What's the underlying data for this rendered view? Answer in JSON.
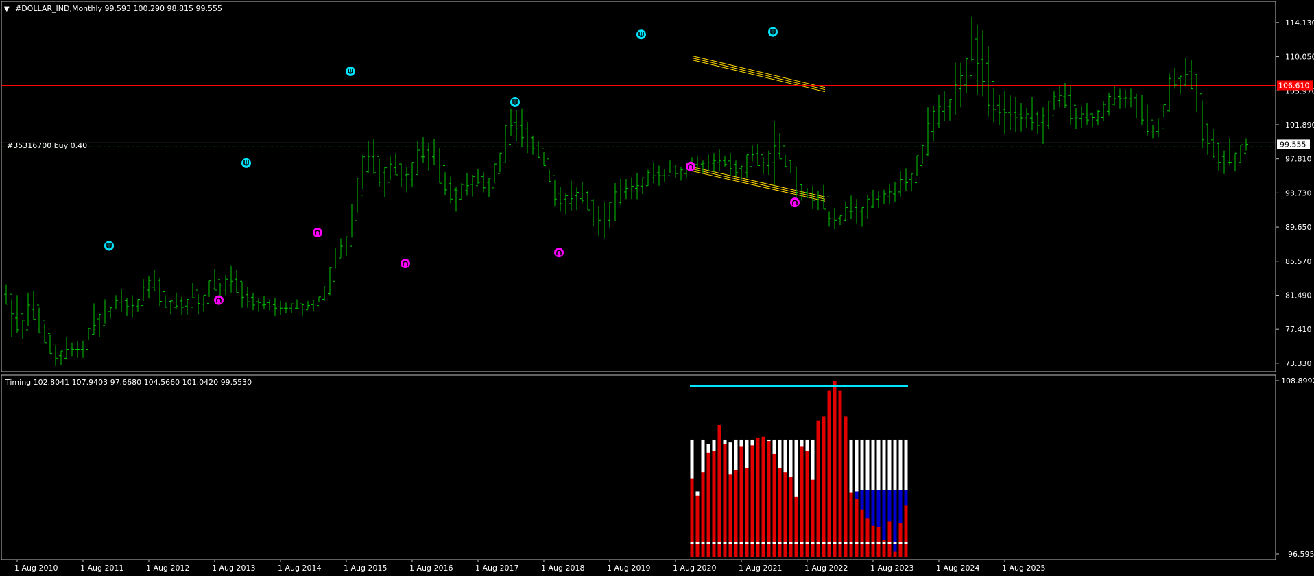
{
  "colors": {
    "background": "#000000",
    "frame": "#c0c0c0",
    "bar": "#00c800",
    "up_arrow": "#00e5ff",
    "down_arrow": "#ff00ff",
    "resistance": "#ff0000",
    "order": "#00c800",
    "channel": "#ffd700",
    "hist_red": "#e00000",
    "hist_white": "#ffffff",
    "hist_blue": "#0000cc",
    "hist_line": "#00e5ff"
  },
  "main": {
    "title_arrow": "▼",
    "header": "#DOLLAR_IND,Monthly  99.593 100.290 98.815 99.555",
    "order_label": "#35316700 buy 0.40",
    "price_tag": "99.555",
    "resistance_tag": "106.610",
    "price_ticks": [
      "114.130",
      "110.050",
      "105.970",
      "101.890",
      "97.810",
      "93.730",
      "89.650",
      "85.570",
      "81.490",
      "77.410",
      "73.330"
    ],
    "ylim": [
      72.5,
      116.5
    ]
  },
  "date_ticks": [
    "1 Aug 2010",
    "1 Aug 2011",
    "1 Aug 2012",
    "1 Aug 2013",
    "1 Aug 2014",
    "1 Aug 2015",
    "1 Aug 2016",
    "1 Aug 2017",
    "1 Aug 2018",
    "1 Aug 2019",
    "1 Aug 2020",
    "1 Aug 2021",
    "1 Aug 2022",
    "1 Aug 2023",
    "1 Aug 2024",
    "1 Aug 2025"
  ],
  "sub": {
    "header": "Timing 102.8041 107.9403 97.6680 104.5660 101.0420 99.5530",
    "top_tick": "108.8992",
    "bottom_tick": "96.5957"
  },
  "chart_data": [
    {
      "type": "ohlc",
      "title": "#DOLLAR_IND,Monthly",
      "x_start": "2010-06",
      "x_step": "1 month",
      "points": [
        [
          82.8,
          80.4
        ],
        [
          81.0,
          76.5
        ],
        [
          81.5,
          77.0
        ],
        [
          78.5,
          76.2
        ],
        [
          81.8,
          77.8
        ],
        [
          82.0,
          78.6
        ],
        [
          80.0,
          77.0
        ],
        [
          78.0,
          75.8
        ],
        [
          76.8,
          74.5
        ],
        [
          75.5,
          73.0
        ],
        [
          74.8,
          73.1
        ],
        [
          76.5,
          73.8
        ],
        [
          75.8,
          74.2
        ],
        [
          76.0,
          74.0
        ],
        [
          76.0,
          74.0
        ],
        [
          77.5,
          76.1
        ],
        [
          80.5,
          76.8
        ],
        [
          79.2,
          76.5
        ],
        [
          81.0,
          78.1
        ],
        [
          80.0,
          78.7
        ],
        [
          81.5,
          79.8
        ],
        [
          82.2,
          79.5
        ],
        [
          81.2,
          79.0
        ],
        [
          81.5,
          78.8
        ],
        [
          81.0,
          79.5
        ],
        [
          83.4,
          80.8
        ],
        [
          83.8,
          81.1
        ],
        [
          84.5,
          82.0
        ],
        [
          83.6,
          80.2
        ],
        [
          81.5,
          80.0
        ],
        [
          80.9,
          79.2
        ],
        [
          81.8,
          79.8
        ],
        [
          81.3,
          79.1
        ],
        [
          81.0,
          79.1
        ],
        [
          83.0,
          81.2
        ],
        [
          81.6,
          79.2
        ],
        [
          81.5,
          79.5
        ],
        [
          83.2,
          81.3
        ],
        [
          84.6,
          82.1
        ],
        [
          83.0,
          81.0
        ],
        [
          83.9,
          81.5
        ],
        [
          85.0,
          81.8
        ],
        [
          84.5,
          81.8
        ],
        [
          83.1,
          80.0
        ],
        [
          82.5,
          80.0
        ],
        [
          81.7,
          79.7
        ],
        [
          81.1,
          79.5
        ],
        [
          81.4,
          79.8
        ],
        [
          81.0,
          79.7
        ],
        [
          81.2,
          79.0
        ],
        [
          80.8,
          79.1
        ],
        [
          80.6,
          79.3
        ],
        [
          80.5,
          79.4
        ],
        [
          81.0,
          79.9
        ],
        [
          80.5,
          79.0
        ],
        [
          80.8,
          79.9
        ],
        [
          80.9,
          79.6
        ],
        [
          81.3,
          80.7
        ],
        [
          82.5,
          80.8
        ],
        [
          84.8,
          81.5
        ],
        [
          87.2,
          84.7
        ],
        [
          88.3,
          86.0
        ],
        [
          88.5,
          86.2
        ],
        [
          92.4,
          88.4
        ],
        [
          95.5,
          91.4
        ],
        [
          98.3,
          94.2
        ],
        [
          100.0,
          96.1
        ],
        [
          100.2,
          96.0
        ],
        [
          97.8,
          94.5
        ],
        [
          96.8,
          93.2
        ],
        [
          98.2,
          95.3
        ],
        [
          98.5,
          95.9
        ],
        [
          97.3,
          94.5
        ],
        [
          96.8,
          93.8
        ],
        [
          97.4,
          94.5
        ],
        [
          100.0,
          96.1
        ],
        [
          100.4,
          97.3
        ],
        [
          99.7,
          96.4
        ],
        [
          100.2,
          97.1
        ],
        [
          99.1,
          94.9
        ],
        [
          96.2,
          93.5
        ],
        [
          95.7,
          92.5
        ],
        [
          94.5,
          91.5
        ],
        [
          94.9,
          93.1
        ],
        [
          96.1,
          93.4
        ],
        [
          95.9,
          93.3
        ],
        [
          96.6,
          94.8
        ],
        [
          96.2,
          93.8
        ],
        [
          95.5,
          93.2
        ],
        [
          97.2,
          94.9
        ],
        [
          98.5,
          96.2
        ],
        [
          101.8,
          97.3
        ],
        [
          103.8,
          100.5
        ],
        [
          103.6,
          100.0
        ],
        [
          103.8,
          99.2
        ],
        [
          102.2,
          98.5
        ],
        [
          100.6,
          98.3
        ],
        [
          100.0,
          98.0
        ],
        [
          98.6,
          97.0
        ],
        [
          96.5,
          95.1
        ],
        [
          95.3,
          92.1
        ],
        [
          94.5,
          91.5
        ],
        [
          93.7,
          91.2
        ],
        [
          95.2,
          91.6
        ],
        [
          94.4,
          91.7
        ],
        [
          95.1,
          92.5
        ],
        [
          94.0,
          91.7
        ],
        [
          93.0,
          89.7
        ],
        [
          92.1,
          88.6
        ],
        [
          92.6,
          88.3
        ],
        [
          92.6,
          89.6
        ],
        [
          94.9,
          90.3
        ],
        [
          95.4,
          92.3
        ],
        [
          95.4,
          93.0
        ],
        [
          95.6,
          93.0
        ],
        [
          96.1,
          93.0
        ],
        [
          95.6,
          93.6
        ],
        [
          96.5,
          94.6
        ],
        [
          97.4,
          94.9
        ],
        [
          97.0,
          94.6
        ],
        [
          96.6,
          95.0
        ],
        [
          97.6,
          96.1
        ],
        [
          97.1,
          95.6
        ],
        [
          96.9,
          95.2
        ],
        [
          97.4,
          95.6
        ],
        [
          98.0,
          96.3
        ],
        [
          98.1,
          96.3
        ],
        [
          97.6,
          96.1
        ],
        [
          98.3,
          96.3
        ],
        [
          98.5,
          96.2
        ],
        [
          98.9,
          96.3
        ],
        [
          98.2,
          96.9
        ],
        [
          98.5,
          95.8
        ],
        [
          97.6,
          95.7
        ],
        [
          97.0,
          95.3
        ],
        [
          98.3,
          95.5
        ],
        [
          99.4,
          97.5
        ],
        [
          99.6,
          97.0
        ],
        [
          98.0,
          96.0
        ],
        [
          98.8,
          95.9
        ],
        [
          102.3,
          94.6
        ],
        [
          100.9,
          97.8
        ],
        [
          98.3,
          96.9
        ],
        [
          97.6,
          96.1
        ],
        [
          96.9,
          92.5
        ],
        [
          94.8,
          92.8
        ],
        [
          94.3,
          93.1
        ],
        [
          94.6,
          91.8
        ],
        [
          94.0,
          91.7
        ],
        [
          94.7,
          91.8
        ],
        [
          91.5,
          89.7
        ],
        [
          91.9,
          89.4
        ],
        [
          91.0,
          89.9
        ],
        [
          92.7,
          90.4
        ],
        [
          93.4,
          90.6
        ],
        [
          93.0,
          90.1
        ],
        [
          92.0,
          89.7
        ],
        [
          93.5,
          90.6
        ],
        [
          94.1,
          91.9
        ],
        [
          93.9,
          91.9
        ],
        [
          94.1,
          92.4
        ],
        [
          94.8,
          92.4
        ],
        [
          95.0,
          92.7
        ],
        [
          96.3,
          93.3
        ],
        [
          96.7,
          94.0
        ],
        [
          96.0,
          93.9
        ],
        [
          98.2,
          95.8
        ],
        [
          99.4,
          97.2
        ],
        [
          104.0,
          98.2
        ],
        [
          104.1,
          100.0
        ],
        [
          105.5,
          101.5
        ],
        [
          105.9,
          102.3
        ],
        [
          104.9,
          102.4
        ],
        [
          109.3,
          103.1
        ],
        [
          109.3,
          104.0
        ],
        [
          109.8,
          105.7
        ],
        [
          114.8,
          109.5
        ],
        [
          113.9,
          105.5
        ],
        [
          113.2,
          105.3
        ],
        [
          111.3,
          102.9
        ],
        [
          106.3,
          102.2
        ],
        [
          105.5,
          101.9
        ],
        [
          105.9,
          100.8
        ],
        [
          105.4,
          101.3
        ],
        [
          105.2,
          101.0
        ],
        [
          104.5,
          101.1
        ],
        [
          103.9,
          101.5
        ],
        [
          105.2,
          101.2
        ],
        [
          103.5,
          100.8
        ],
        [
          104.0,
          99.6
        ],
        [
          104.7,
          101.4
        ],
        [
          105.9,
          103.7
        ],
        [
          106.5,
          104.0
        ],
        [
          106.9,
          103.9
        ],
        [
          106.6,
          101.9
        ],
        [
          103.9,
          101.4
        ],
        [
          104.1,
          101.5
        ],
        [
          104.5,
          101.9
        ],
        [
          103.3,
          101.6
        ],
        [
          103.7,
          101.8
        ],
        [
          104.7,
          102.3
        ],
        [
          105.7,
          103.0
        ],
        [
          106.5,
          104.1
        ],
        [
          106.2,
          103.8
        ],
        [
          106.1,
          103.9
        ],
        [
          106.2,
          104.0
        ],
        [
          105.6,
          102.7
        ],
        [
          105.5,
          101.8
        ],
        [
          104.3,
          100.6
        ],
        [
          101.9,
          100.3
        ],
        [
          102.6,
          100.4
        ],
        [
          104.3,
          102.8
        ],
        [
          108.0,
          103.4
        ],
        [
          108.7,
          106.2
        ],
        [
          107.7,
          105.6
        ],
        [
          109.9,
          106.7
        ],
        [
          109.6,
          106.2
        ],
        [
          107.8,
          103.4
        ],
        [
          104.8,
          99.1
        ],
        [
          101.9,
          98.3
        ],
        [
          101.4,
          97.9
        ],
        [
          99.8,
          96.4
        ],
        [
          98.8,
          96.0
        ],
        [
          100.3,
          97.0
        ],
        [
          98.5,
          96.3
        ],
        [
          99.5,
          97.5
        ],
        [
          100.3,
          98.8
        ]
      ]
    },
    {
      "type": "bar",
      "title": "Timing",
      "ylim": [
        96.5957,
        108.8992
      ],
      "level_line": 108.5,
      "series": [
        {
          "values": [
            104.8,
            101.2,
            104.8,
            104.5,
            104.8,
            104.8,
            104.8,
            104.6,
            104.8,
            104.8,
            104.8,
            104.8,
            104.8,
            104.8,
            104.8,
            104.8,
            104.8,
            104.8,
            104.8,
            104.8,
            104.8,
            104.8,
            104.8,
            104.8,
            104.8,
            104.8,
            104.8,
            104.8,
            104.8,
            104.8,
            104.8,
            104.8,
            104.8,
            104.8,
            104.8,
            104.8,
            104.8,
            104.8,
            104.8,
            104.8
          ]
        },
        {
          "values": [
            102.1,
            100.9,
            102.5,
            103.9,
            104.0,
            105.8,
            104.5,
            102.4,
            102.7,
            104.3,
            102.8,
            104.4,
            104.9,
            105.0,
            104.7,
            103.8,
            102.8,
            102.5,
            102.2,
            100.8,
            104.3,
            104.0,
            102.0,
            106.1,
            106.4,
            108.2,
            108.9,
            108.2,
            106.4,
            101.1,
            100.7,
            99.9,
            99.3,
            98.8,
            98.7,
            97.8,
            99.1,
            97.0,
            99.0,
            100.2
          ]
        },
        {
          "values": [
            0,
            0,
            0,
            0,
            0,
            0,
            0,
            0,
            0,
            0,
            0,
            0,
            0,
            0,
            0,
            0,
            0,
            0,
            0,
            0,
            0,
            0,
            0,
            0,
            0,
            0,
            0,
            0,
            0,
            0,
            101.2,
            101.3,
            101.3,
            101.3,
            101.3,
            101.3,
            101.3,
            101.3,
            101.3,
            101.3
          ]
        }
      ]
    }
  ]
}
